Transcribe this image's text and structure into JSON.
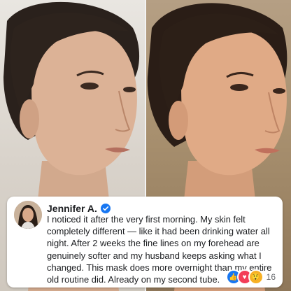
{
  "review": {
    "author": "Jennifer A.",
    "text": "I noticed it after the very first morning. My skin felt completely different — like it had been drinking water all night. After 2 weeks the fine lines on my forehead are genuinely softer and my husband keeps asking what I changed. This mask does more overnight than my entire old routine did. Already on my second tube.",
    "reaction_count": "16",
    "verified_icon": "verified-badge-icon",
    "reactions": [
      "like-icon",
      "love-icon",
      "wow-icon"
    ]
  },
  "colors": {
    "verified": "#1877f2",
    "like": "#1877f2",
    "love": "#f33e58",
    "wow": "#f7b125"
  }
}
